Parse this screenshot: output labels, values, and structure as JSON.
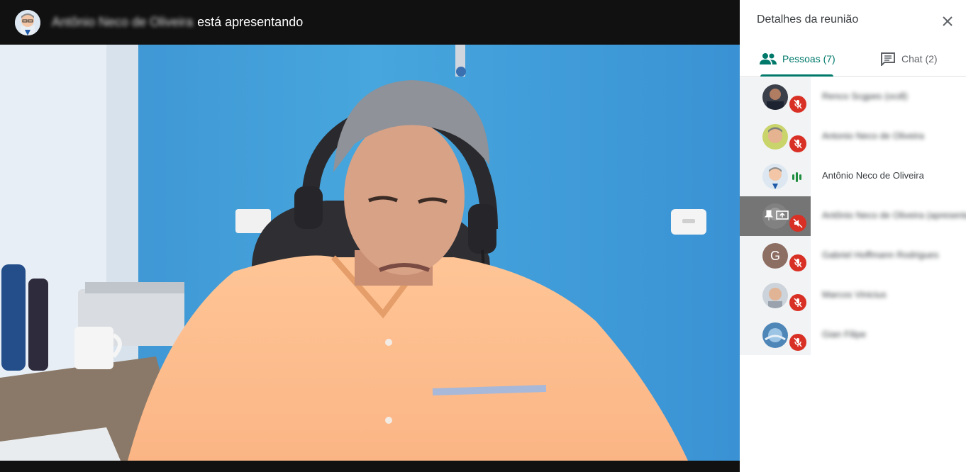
{
  "topbar": {
    "presenter_name": "Antônio Neco de Oliveira",
    "presenting_text": "está apresentando"
  },
  "panel": {
    "title": "Detalhes da reunião",
    "tabs": [
      {
        "label": "Pessoas (7)",
        "icon": "people-icon",
        "active": true
      },
      {
        "label": "Chat (2)",
        "icon": "chat-icon",
        "active": false
      }
    ],
    "participants": [
      {
        "name": "Renco Scgpes (ocdl)",
        "muted": true
      },
      {
        "name": "Antonio Neco de Oliveira",
        "muted": true
      },
      {
        "name": "Antônio Neco de Oliveira",
        "muted": false,
        "speaking": true
      },
      {
        "name": "Antônio Neco de Oliveira (apresentação)",
        "muted": true,
        "presentation": true
      },
      {
        "name": "Gabriel Hoffmann Rodrigues",
        "muted": true,
        "initial": "G"
      },
      {
        "name": "Marcos Vinicius",
        "muted": true
      },
      {
        "name": "Gian Filipe",
        "muted": true
      }
    ]
  },
  "colors": {
    "accent": "#00796b",
    "muted_red": "#d93025",
    "speaking_green": "#1e8e3e"
  }
}
